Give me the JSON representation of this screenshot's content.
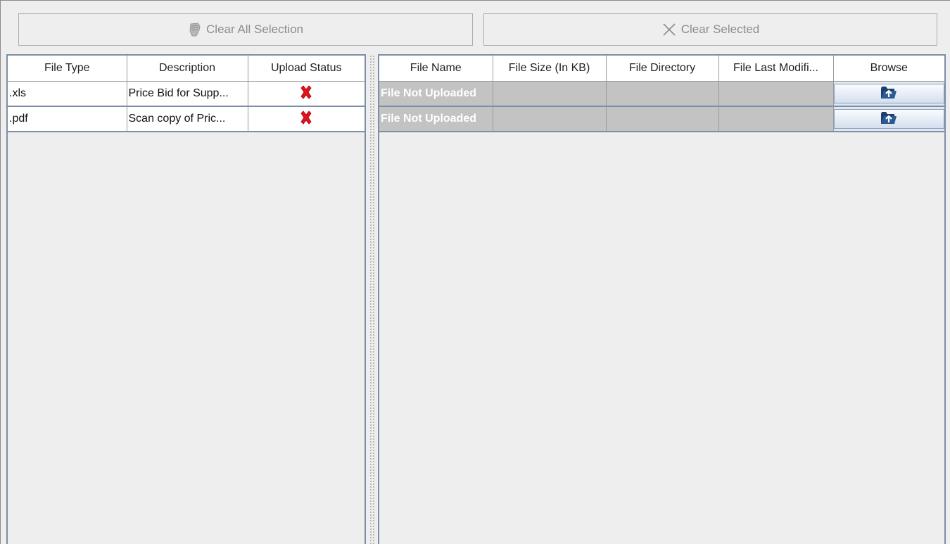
{
  "toolbar": {
    "clear_all_label": "Clear All Selection",
    "clear_selected_label": "Clear Selected"
  },
  "left_table": {
    "columns": [
      "File Type",
      "Description",
      "Upload Status"
    ],
    "rows": [
      {
        "file_type": ".xls",
        "description": "Price Bid for Supp...",
        "status_icon": "red-x-icon"
      },
      {
        "file_type": ".pdf",
        "description": "Scan copy of Pric...",
        "status_icon": "red-x-icon"
      }
    ]
  },
  "right_table": {
    "columns": [
      "File Name",
      "File Size (In KB)",
      "File Directory",
      "File Last Modifi...",
      "Browse"
    ],
    "rows": [
      {
        "file_name": "File Not Uploaded",
        "file_size": "",
        "file_directory": "",
        "file_last_modified": "",
        "browse_icon": "folder-upload-icon"
      },
      {
        "file_name": "File Not Uploaded",
        "file_size": "",
        "file_directory": "",
        "file_last_modified": "",
        "browse_icon": "folder-upload-icon"
      }
    ]
  },
  "colors": {
    "status_error": "#e0141e",
    "disabled_text": "#8d8d8d",
    "border_blue": "#7d8fa6",
    "cell_gray": "#c3c3c3",
    "folder_navy": "#1d3e6e"
  }
}
